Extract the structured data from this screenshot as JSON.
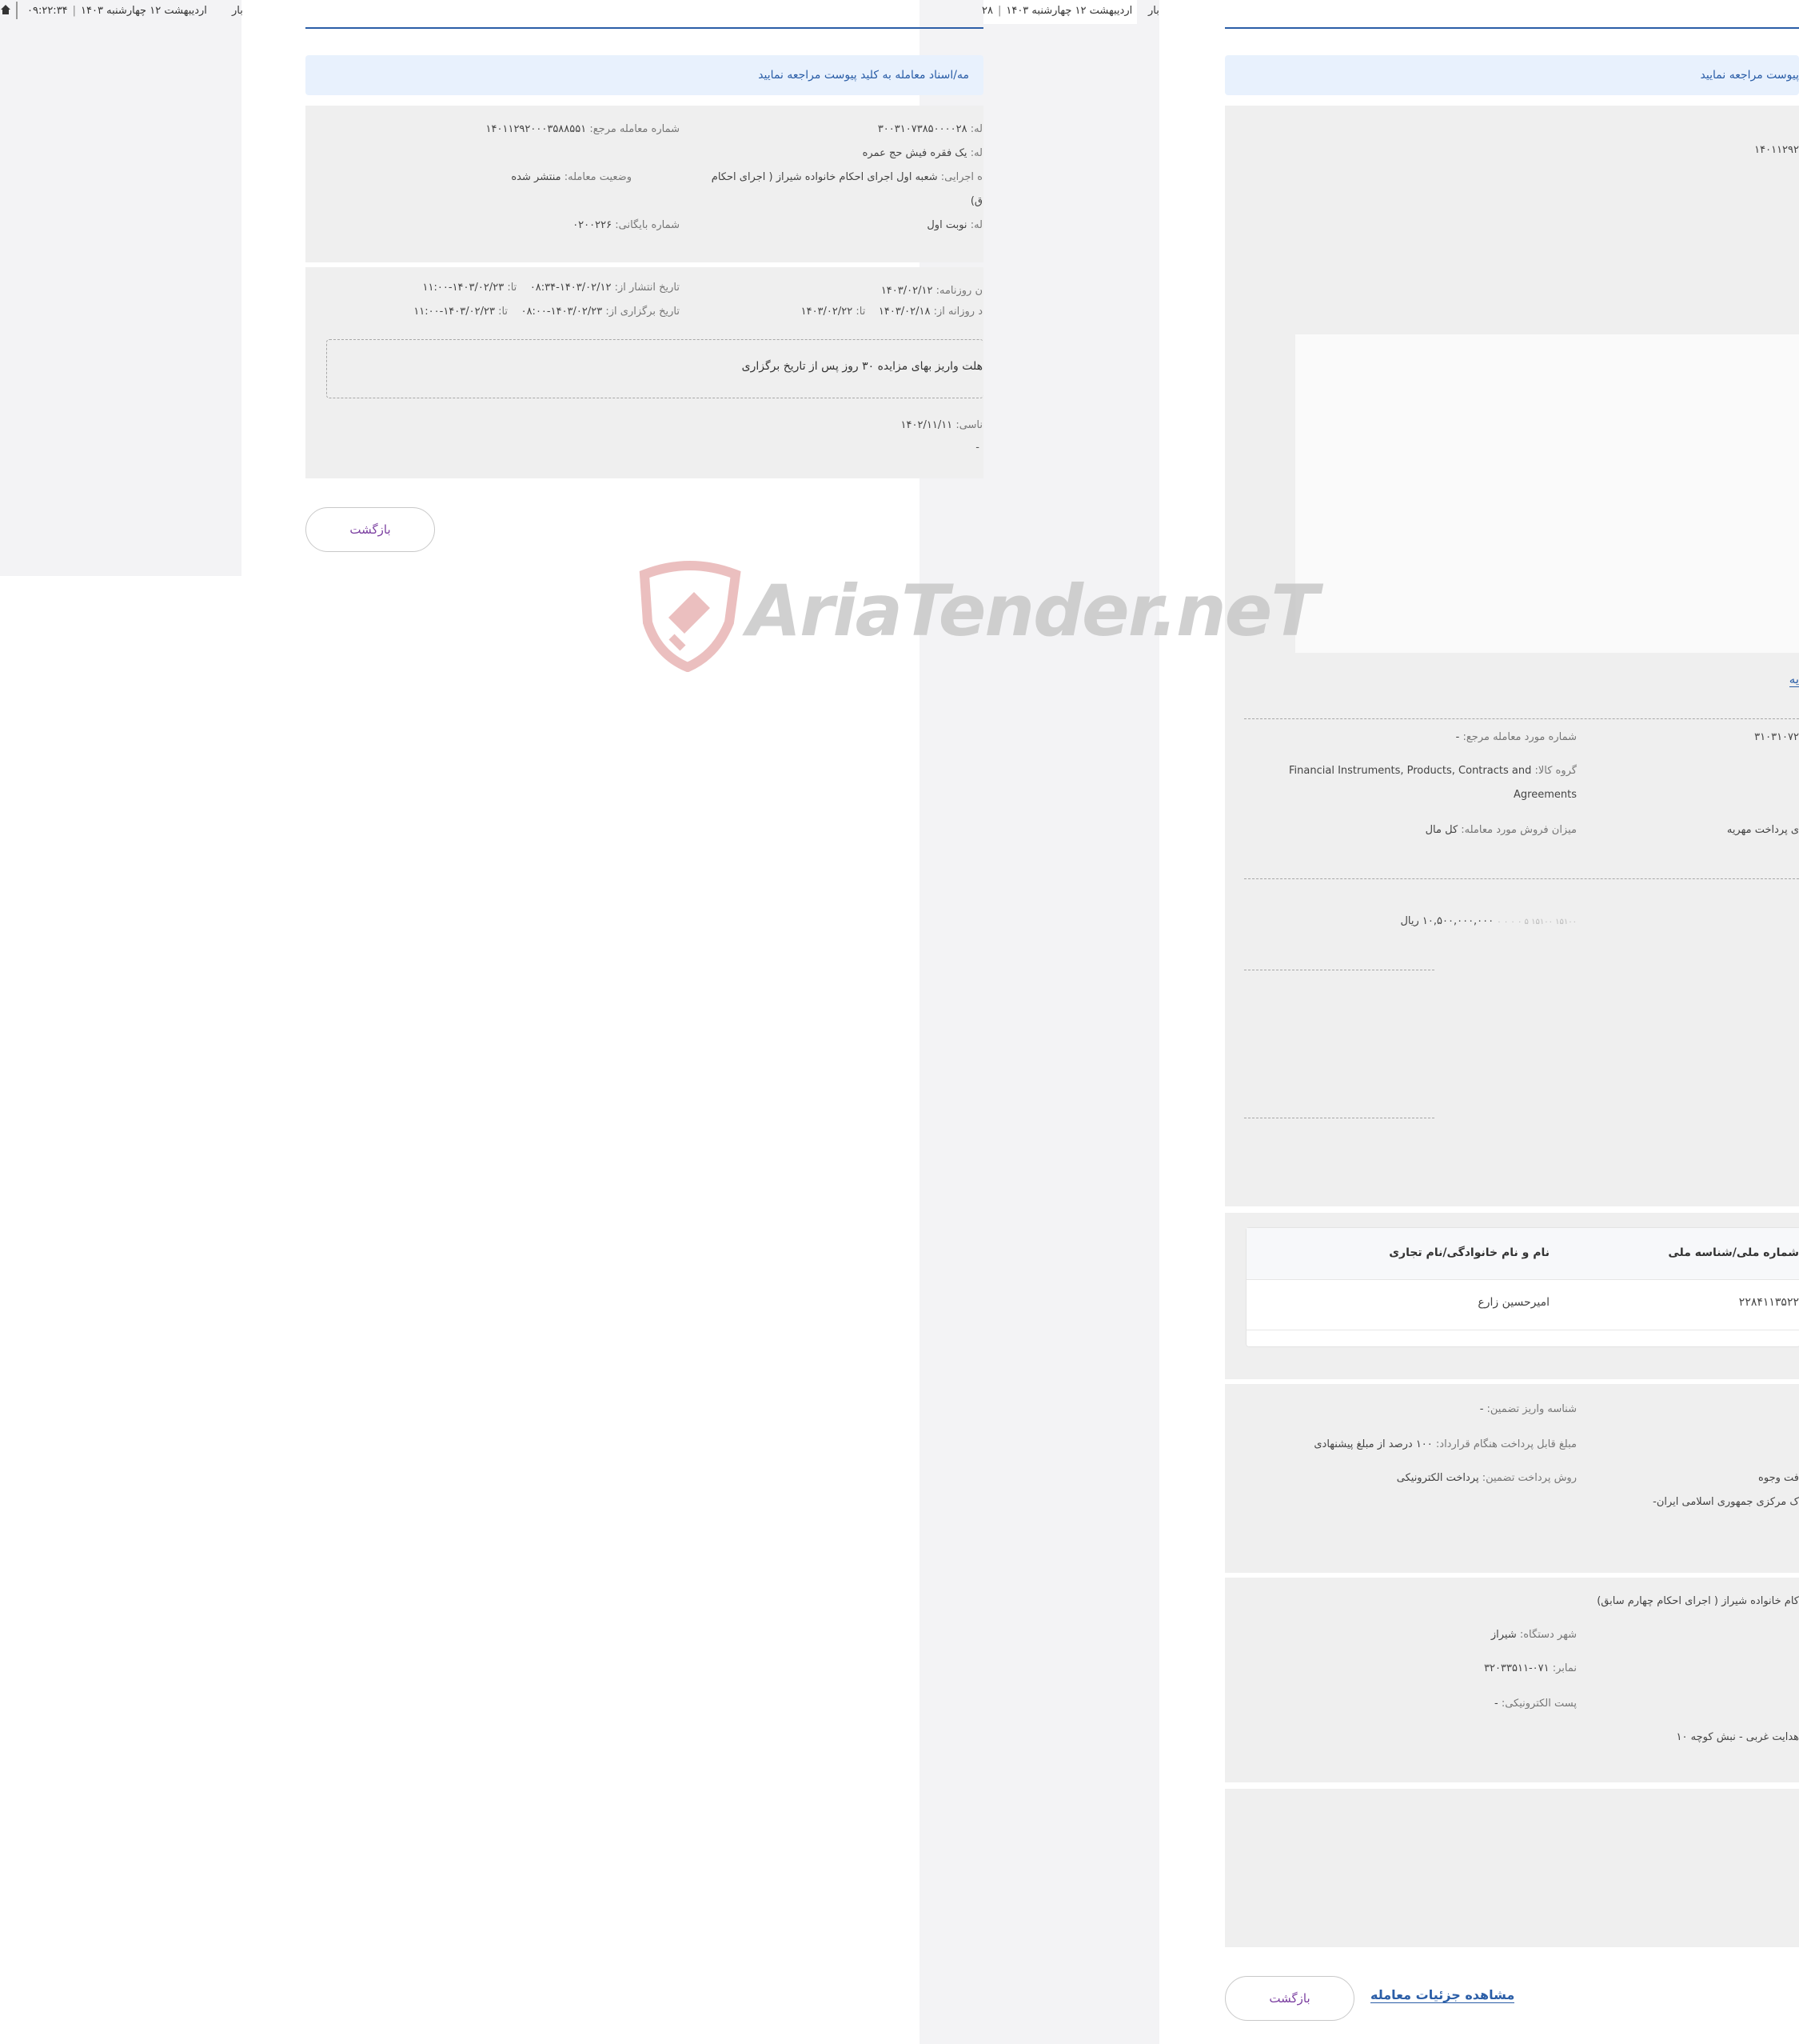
{
  "back_window": {
    "datebar": {
      "time": "۰۹:۲۲:۳۴",
      "date": "اردیبهشت ۱۲ چهارشنبه ۱۴۰۳",
      "fragment": "بار"
    },
    "notice": "مه/اسناد معامله به کلید پیوست مراجعه نمایید",
    "details": {
      "deal_number_label": "له:",
      "deal_number_value": "۳۰۰۳۱۰۷۳۸۵۰۰۰۰۲۸",
      "ref_number_label": "شماره معامله مرجع:",
      "ref_number_value": "۱۴۰۱۱۲۹۲۰۰۰۳۵۸۸۵۵۱",
      "subject_label": "له:",
      "subject_value": "یک فقره فیش حج عمره",
      "unit_label": "ه اجرایی:",
      "unit_value": "شعبه اول اجرای احکام خانواده شیراز ( اجرای احکام",
      "status_label": "وضعیت معامله:",
      "status_value": "منتشر شده",
      "unit_cont": "ق)",
      "round_label": "له:",
      "round_value": "نوبت اول",
      "archive_label": "شماره بایگانی:",
      "archive_value": "۰۲۰۰۲۲۶"
    },
    "dates": {
      "newspaper_label": "ن روزنامه:",
      "newspaper_value": "۱۴۰۳/۰۲/۱۲",
      "publish_from_label": "تاریخ انتشار از:",
      "publish_from_value": "۱۴۰۳/۰۲/۱۲-۰۸:۳۴",
      "publish_to_label": "تا:",
      "publish_to_value": "۱۴۰۳/۰۲/۲۳-۱۱:۰۰",
      "visit_from_label": "د روزانه از:",
      "visit_from_value": "۱۴۰۳/۰۲/۱۸",
      "visit_to_label": "تا:",
      "visit_to_value": "۱۴۰۳/۰۲/۲۲",
      "hold_from_label": "تاریخ برگزاری از:",
      "hold_from_value": "۱۴۰۳/۰۲/۲۳-۰۸:۰۰",
      "hold_to_label": "تا:",
      "hold_to_value": "۱۴۰۳/۰۲/۲۳-۱۱:۰۰",
      "payment_note": "هلت واریز بهای مزایده ۳۰ روز پس از تاریخ برگزاری",
      "expert_label": "ناسی:",
      "expert_value": "۱۴۰۲/۱۱/۱۱",
      "dash": "-"
    },
    "back_button": "بازگشت"
  },
  "mid_bar": {
    "fragment": "۲۸",
    "date": "اردیبهشت ۱۲ چهارشنبه ۱۴۰۳",
    "fragment2": "بار"
  },
  "front_window": {
    "notice": "پیوست مراجعه نمایید",
    "ref_number_fragment": "۱۴۰۱۱۲۹۲",
    "section_link_fragment": "یه",
    "details": {
      "ref_item_label": "شماره مورد معامله مرجع:",
      "ref_item_value": "-",
      "deal_no_fragment": "۳۱۰۳۱۰۷۲",
      "goods_group_label": "گروه کالا:",
      "goods_group_value_1": "Financial Instruments, Products, Contracts and",
      "goods_group_value_2": "Agreements",
      "sale_amount_label": "میزان فروش مورد معامله:",
      "sale_amount_value": "کل مال",
      "reason_fragment": "ی پرداخت مهریه"
    },
    "price": {
      "faded": "۱۵۱۰۰ ۱۵۱۰۰ ۵ ۰ ۰ ۰ ۰",
      "value": "۱۰,۵۰۰,۰۰۰,۰۰۰ ریال"
    },
    "table": {
      "headers": [
        "شماره ملی/شناسه ملی",
        "نام و نام خانوادگی/نام تجاری"
      ],
      "rows": [
        [
          "۲۲۸۴۱۱۳۵۲۲",
          "امیرحسین زارع"
        ]
      ]
    },
    "guarantee": {
      "deposit_id_label": "شناسه واریز تضمین:",
      "deposit_id_value": "-",
      "contract_pay_label": "مبلغ قابل پرداخت هنگام قرارداد:",
      "contract_pay_value": "۱۰۰ درصد از مبلغ پیشنهادی",
      "receive_fragment": "فت وجوه",
      "method_label": "روش پرداخت تضمین:",
      "method_value": "پرداخت الکترونیکی",
      "bank_fragment": "ک مرکزی جمهوری اسلامی ایران-"
    },
    "org": {
      "name_fragment": "کام خانواده شیراز ( اجرای احکام چهارم سابق)",
      "city_label": "شهر دستگاه:",
      "city_value": "شیراز",
      "fax_label": "نمابر:",
      "fax_value": "۰۷۱-۳۲۰۳۳۵۱۱",
      "email_label": "پست الکترونیکی:",
      "email_value": "-",
      "address_fragment": "هدایت غربی - نبش کوچه ۱۰"
    },
    "back_button": "بازگشت",
    "details_link": "مشاهده جزئیات معامله"
  },
  "watermark": {
    "text": "AriaTender.neT"
  },
  "colors": {
    "accent_blue": "#2b5ea7",
    "purple": "#7b3fa0",
    "notice_bg": "#e8f1fd",
    "card_bg": "#efefef"
  }
}
